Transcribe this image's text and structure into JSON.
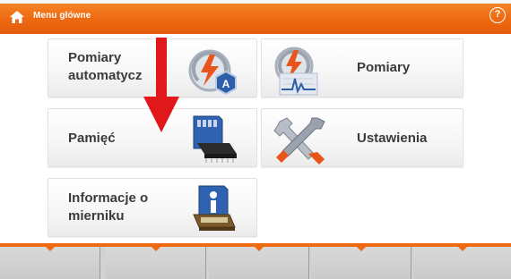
{
  "header": {
    "title": "Menu główne",
    "help_glyph": "?",
    "accent_color": "#ee6a12"
  },
  "tiles": [
    {
      "label": "Pomiary\nautomatycz",
      "icon": "auto-measurement-icon"
    },
    {
      "label": "Pomiary",
      "icon": "measurement-icon"
    },
    {
      "label": "Pamięć",
      "icon": "memory-chip-icon"
    },
    {
      "label": "Ustawienia",
      "icon": "settings-tools-icon"
    },
    {
      "label": "Informacje o\nmierniku",
      "icon": "meter-info-icon"
    }
  ],
  "softkeys": [
    {
      "label": ""
    },
    {
      "label": ""
    },
    {
      "label": ""
    },
    {
      "label": ""
    },
    {
      "label": ""
    }
  ],
  "overlay": {
    "icon": "red-down-arrow-icon",
    "color": "#e0181b"
  }
}
